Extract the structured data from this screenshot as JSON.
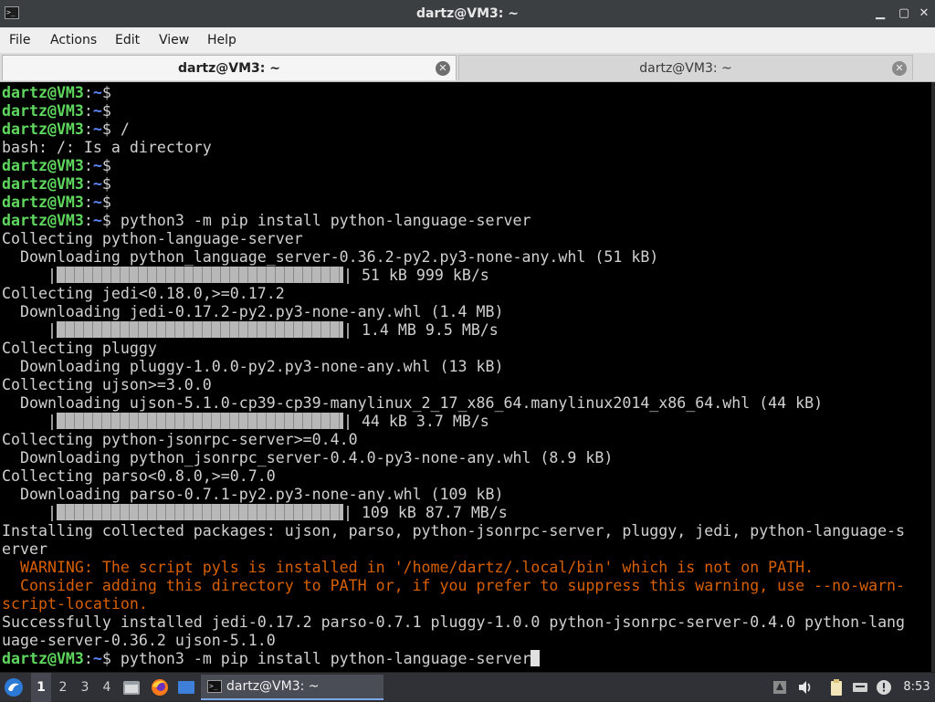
{
  "window": {
    "title": "dartz@VM3: ~",
    "controls": {
      "minimize": "▁",
      "maximize": "▢",
      "close": "✕"
    }
  },
  "menu": {
    "items": [
      "File",
      "Actions",
      "Edit",
      "View",
      "Help"
    ]
  },
  "tabs": [
    {
      "label": "dartz@VM3: ~",
      "active": true
    },
    {
      "label": "dartz@VM3: ~",
      "active": false
    }
  ],
  "terminal": {
    "prompt_user": "dartz@VM3",
    "prompt_path": "~",
    "lines": [
      {
        "type": "prompt",
        "cmd": ""
      },
      {
        "type": "prompt",
        "cmd": ""
      },
      {
        "type": "prompt",
        "cmd": " /"
      },
      {
        "type": "text",
        "text": "bash: /: Is a directory"
      },
      {
        "type": "prompt",
        "cmd": ""
      },
      {
        "type": "prompt",
        "cmd": ""
      },
      {
        "type": "prompt",
        "cmd": ""
      },
      {
        "type": "prompt",
        "cmd": " python3 -m pip install python-language-server"
      },
      {
        "type": "text",
        "text": "Collecting python-language-server"
      },
      {
        "type": "text",
        "text": "  Downloading python_language_server-0.36.2-py2.py3-none-any.whl (51 kB)"
      },
      {
        "type": "progress",
        "text": "51 kB 999 kB/s",
        "fraction": 1.0
      },
      {
        "type": "text",
        "text": "Collecting jedi<0.18.0,>=0.17.2"
      },
      {
        "type": "text",
        "text": "  Downloading jedi-0.17.2-py2.py3-none-any.whl (1.4 MB)"
      },
      {
        "type": "progress",
        "text": "1.4 MB 9.5 MB/s",
        "fraction": 1.0
      },
      {
        "type": "text",
        "text": "Collecting pluggy"
      },
      {
        "type": "text",
        "text": "  Downloading pluggy-1.0.0-py2.py3-none-any.whl (13 kB)"
      },
      {
        "type": "text",
        "text": "Collecting ujson>=3.0.0"
      },
      {
        "type": "text",
        "text": "  Downloading ujson-5.1.0-cp39-cp39-manylinux_2_17_x86_64.manylinux2014_x86_64.whl (44 kB)"
      },
      {
        "type": "progress",
        "text": "44 kB 3.7 MB/s",
        "fraction": 1.0
      },
      {
        "type": "text",
        "text": "Collecting python-jsonrpc-server>=0.4.0"
      },
      {
        "type": "text",
        "text": "  Downloading python_jsonrpc_server-0.4.0-py3-none-any.whl (8.9 kB)"
      },
      {
        "type": "text",
        "text": "Collecting parso<0.8.0,>=0.7.0"
      },
      {
        "type": "text",
        "text": "  Downloading parso-0.7.1-py2.py3-none-any.whl (109 kB)"
      },
      {
        "type": "progress",
        "text": "109 kB 87.7 MB/s",
        "fraction": 1.0
      },
      {
        "type": "text",
        "text": "Installing collected packages: ujson, parso, python-jsonrpc-server, pluggy, jedi, python-language-s"
      },
      {
        "type": "text",
        "text": "erver"
      },
      {
        "type": "warn",
        "text": "  WARNING: The script pyls is installed in '/home/dartz/.local/bin' which is not on PATH."
      },
      {
        "type": "warn",
        "text": "  Consider adding this directory to PATH or, if you prefer to suppress this warning, use --no-warn-"
      },
      {
        "type": "warn",
        "text": "script-location."
      },
      {
        "type": "text",
        "text": "Successfully installed jedi-0.17.2 parso-0.7.1 pluggy-1.0.0 python-jsonrpc-server-0.4.0 python-lang"
      },
      {
        "type": "text",
        "text": "uage-server-0.36.2 ujson-5.1.0"
      },
      {
        "type": "prompt",
        "cmd": " python3 -m pip install python-language-server",
        "cursor": true
      }
    ]
  },
  "taskbar": {
    "workspaces": [
      "1",
      "2",
      "3",
      "4"
    ],
    "active_workspace": "1",
    "launchers": [
      "file-manager-icon",
      "firefox-icon",
      "desktop-icon"
    ],
    "task_label": "dartz@VM3: ~",
    "tray": [
      "update-icon",
      "volume-icon",
      "clipboard-icon",
      "network-icon",
      "notification-icon",
      "display-icon"
    ],
    "clock": "8:53"
  },
  "colors": {
    "prompt_user": "#5fd75f",
    "prompt_path": "#5f87ff",
    "warning": "#d75f00",
    "terminal_bg": "#000000"
  }
}
